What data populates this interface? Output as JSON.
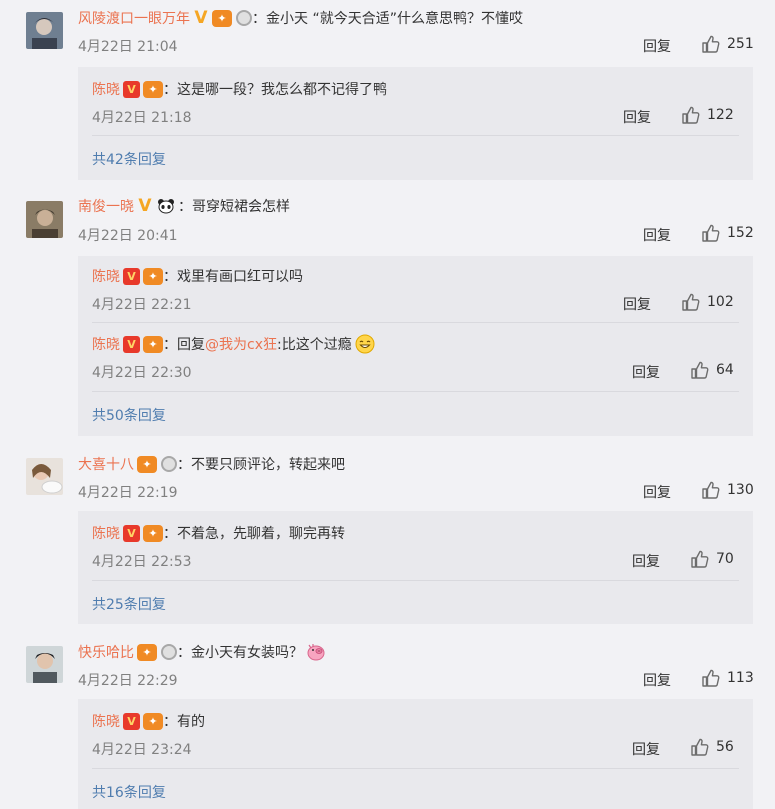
{
  "comments": [
    {
      "user": "风陵渡口一眼万年",
      "text": "：金小天 “就今天合适”什么意思鸭？不懂哎",
      "time": "4月22日 21:04",
      "reply_label": "回复",
      "likes": "251",
      "subs": [
        {
          "user": "陈晓",
          "text": "：这是哪一段？我怎么都不记得了鸭",
          "time": "4月22日 21:18",
          "reply_label": "回复",
          "likes": "122"
        }
      ],
      "more": "共42条回复"
    },
    {
      "user": "南俊一晓",
      "text": "：哥穿短裙会怎样",
      "time": "4月22日 20:41",
      "reply_label": "回复",
      "likes": "152",
      "subs": [
        {
          "user": "陈晓",
          "text": "：戏里有画口红可以吗",
          "time": "4月22日 22:21",
          "reply_label": "回复",
          "likes": "102"
        },
        {
          "user": "陈晓",
          "text_prefix": "：回复",
          "mention": "@我为cx狂",
          "text": ":比这个过瘾",
          "time": "4月22日 22:30",
          "reply_label": "回复",
          "likes": "64"
        }
      ],
      "more": "共50条回复"
    },
    {
      "user": "大喜十八",
      "text": "：不要只顾评论，转起来吧",
      "time": "4月22日 22:19",
      "reply_label": "回复",
      "likes": "130",
      "subs": [
        {
          "user": "陈晓",
          "text": "：不着急，先聊着，聊完再转",
          "time": "4月22日 22:53",
          "reply_label": "回复",
          "likes": "70"
        }
      ],
      "more": "共25条回复"
    },
    {
      "user": "快乐哈比",
      "text": "：金小天有女装吗？",
      "time": "4月22日 22:29",
      "reply_label": "回复",
      "likes": "113",
      "subs": [
        {
          "user": "陈晓",
          "text": "：有的",
          "time": "4月22日 23:24",
          "reply_label": "回复",
          "likes": "56"
        }
      ],
      "more": "共16条回复"
    }
  ],
  "colors": {
    "username": "#eb7350",
    "link": "#507daf",
    "timestamp": "#808080",
    "background": "#f2f2f5",
    "reply_box": "#e9e9ed"
  },
  "badges": {
    "verified": "V",
    "member_icon": "vip-crown-icon",
    "medal_icon": "silver-medal-icon"
  }
}
